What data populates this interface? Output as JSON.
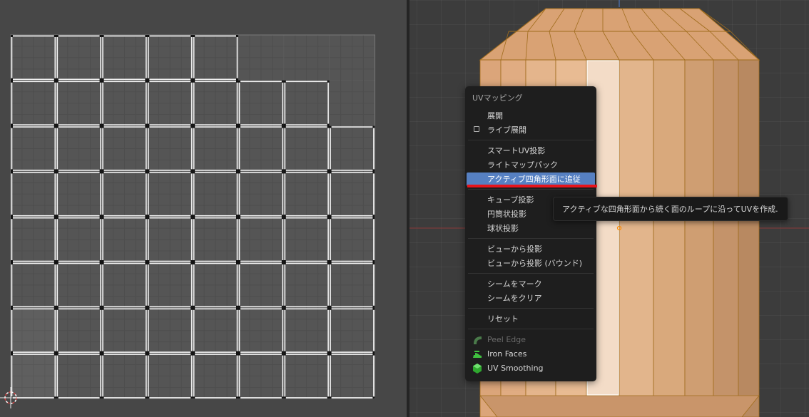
{
  "menu": {
    "title": "UVマッピング",
    "groups": [
      [
        {
          "label": "展開",
          "name": "menu-unwrap"
        },
        {
          "label": "ライブ展開",
          "name": "menu-live-unwrap",
          "checkbox": true,
          "checked": false
        }
      ],
      [
        {
          "label": "スマートUV投影",
          "name": "menu-smart-uv-project"
        },
        {
          "label": "ライトマップパック",
          "name": "menu-lightmap-pack"
        },
        {
          "label": "アクティブ四角形面に追従",
          "name": "menu-follow-active-quads",
          "active": true
        }
      ],
      [
        {
          "label": "キューブ投影",
          "name": "menu-cube-projection"
        },
        {
          "label": "円筒状投影",
          "name": "menu-cylinder-projection"
        },
        {
          "label": "球状投影",
          "name": "menu-sphere-projection"
        }
      ],
      [
        {
          "label": "ビューから投影",
          "name": "menu-project-from-view"
        },
        {
          "label": "ビューから投影 (バウンド)",
          "name": "menu-project-from-view-bounds"
        }
      ],
      [
        {
          "label": "シームをマーク",
          "name": "menu-mark-seam"
        },
        {
          "label": "シームをクリア",
          "name": "menu-clear-seam"
        }
      ],
      [
        {
          "label": "リセット",
          "name": "menu-reset"
        }
      ],
      [
        {
          "label": "Peel Edge",
          "name": "menu-peel-edge",
          "disabled": true,
          "icon": "peel-edge-icon"
        },
        {
          "label": "Iron Faces",
          "name": "menu-iron-faces",
          "icon": "iron-faces-icon"
        },
        {
          "label": "UV Smoothing",
          "name": "menu-uv-smoothing",
          "icon": "uv-smoothing-icon"
        }
      ]
    ]
  },
  "tooltip": {
    "text": "アクティブな四角形面から続く面のループに沿ってUVを作成."
  },
  "colors": {
    "menu_bg": "#1e1e1e",
    "highlight": "#5680c2",
    "annotation_red": "#e8141b",
    "mesh_face": "#c8956a",
    "mesh_edge": "#a06c1c",
    "uv_edge_selected": "#ffffff"
  }
}
